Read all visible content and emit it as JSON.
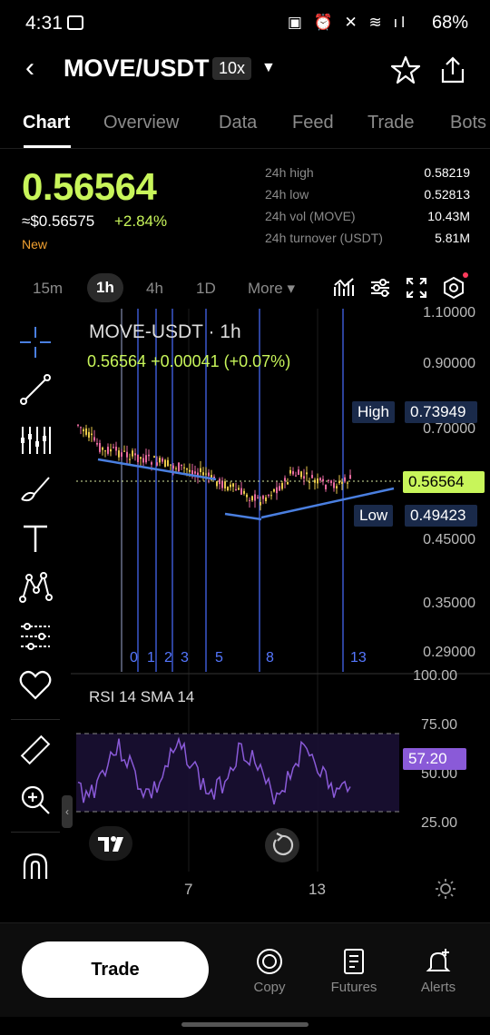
{
  "status_bar": {
    "time": "4:31",
    "battery": "68%"
  },
  "header": {
    "pair": "MOVE/USDT",
    "leverage": "10x"
  },
  "tabs": [
    "Chart",
    "Overview",
    "Data",
    "Feed",
    "Trade",
    "Bots"
  ],
  "price": {
    "last": "0.56564",
    "usd": "≈$0.56575",
    "change": "+2.84%",
    "badge": "New"
  },
  "stats": [
    {
      "label": "24h high",
      "value": "0.58219"
    },
    {
      "label": "24h low",
      "value": "0.52813"
    },
    {
      "label": "24h vol (MOVE)",
      "value": "10.43M"
    },
    {
      "label": "24h turnover (USDT)",
      "value": "5.81M"
    }
  ],
  "intervals": [
    "15m",
    "1h",
    "4h",
    "1D",
    "More ▾"
  ],
  "chart": {
    "title": "MOVE-USDT · 1h",
    "ohlc": "0.56564  +0.00041 (+0.07%)",
    "y_axis": [
      "1.10000",
      "0.90000",
      "0.70000",
      "0.45000",
      "0.35000",
      "0.29000"
    ],
    "high_label": "High",
    "high_value": "0.73949",
    "low_label": "Low",
    "low_value": "0.49423",
    "current_price": "0.56564",
    "fib_labels": [
      "0",
      "1",
      "2",
      "3",
      "5",
      "8",
      "13"
    ],
    "rsi_title": "RSI 14 SMA 14",
    "rsi_axis": [
      "100.00",
      "75.00",
      "50.00",
      "25.00"
    ],
    "rsi_value": "57.20",
    "x_axis": [
      "7",
      "13"
    ]
  },
  "bottom_nav": {
    "trade": "Trade",
    "items": [
      "Copy",
      "Futures",
      "Alerts"
    ]
  },
  "colors": {
    "accent": "#c8f55a",
    "fib_line": "#4466ee",
    "trendline": "#4a7fe0",
    "rsi_line": "#8a5ad8"
  }
}
